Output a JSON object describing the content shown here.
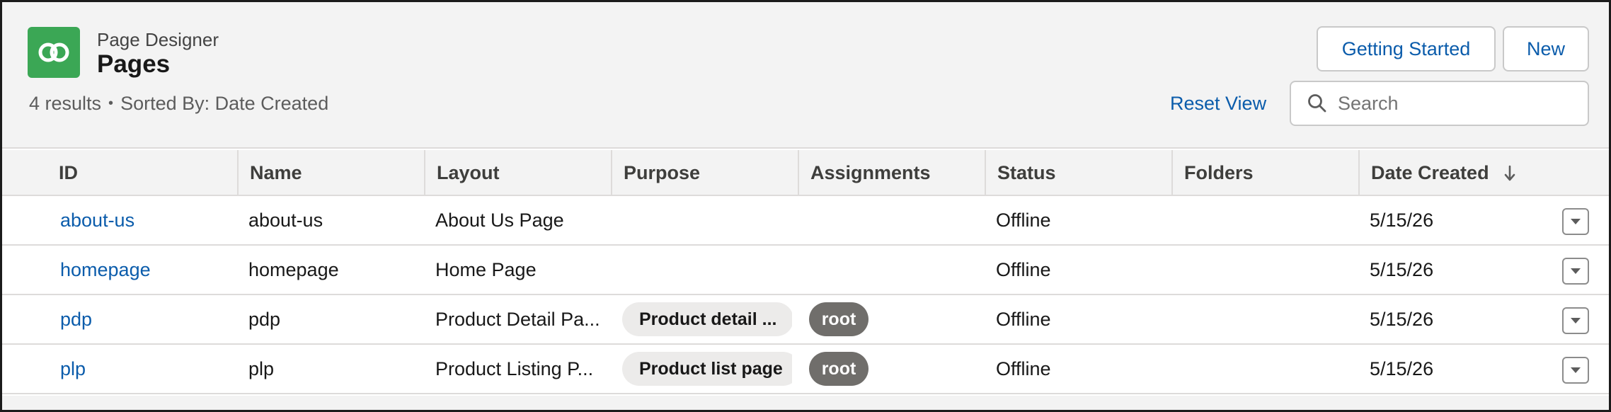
{
  "header": {
    "object_label": "Page Designer",
    "title": "Pages",
    "results_text": "4 results",
    "sort_separator": "•",
    "sort_text": "Sorted By: Date Created",
    "getting_started_label": "Getting Started",
    "new_label": "New",
    "reset_view_label": "Reset View",
    "search_placeholder": "Search",
    "search_value": ""
  },
  "table": {
    "columns": [
      "ID",
      "Name",
      "Layout",
      "Purpose",
      "Assignments",
      "Status",
      "Folders",
      "Date Created"
    ],
    "sorted_column": "Date Created",
    "sort_direction": "descending",
    "rows": [
      {
        "id": "about-us",
        "name": "about-us",
        "layout": "About Us Page",
        "purpose": "",
        "assignment": "",
        "status": "Offline",
        "folders": "",
        "date_created": "5/15/26"
      },
      {
        "id": "homepage",
        "name": "homepage",
        "layout": "Home Page",
        "purpose": "",
        "assignment": "",
        "status": "Offline",
        "folders": "",
        "date_created": "5/15/26"
      },
      {
        "id": "pdp",
        "name": "pdp",
        "layout": "Product Detail Pa...",
        "purpose": "Product detail ...",
        "assignment": "root",
        "status": "Offline",
        "folders": "",
        "date_created": "5/15/26"
      },
      {
        "id": "plp",
        "name": "plp",
        "layout": "Product Listing P...",
        "purpose": "Product list page",
        "assignment": "root",
        "status": "Offline",
        "folders": "",
        "date_created": "5/15/26"
      }
    ]
  },
  "icons": {
    "app": "page-designer-icon",
    "search": "search-icon",
    "sort": "arrow-down-icon",
    "row_action": "chevron-down-icon"
  },
  "colors": {
    "brand_icon": "#3ba755",
    "link": "#0b5cab",
    "header_bg": "#f3f3f3",
    "badge_bg": "#706e6b",
    "pill_bg": "#ecebea"
  }
}
